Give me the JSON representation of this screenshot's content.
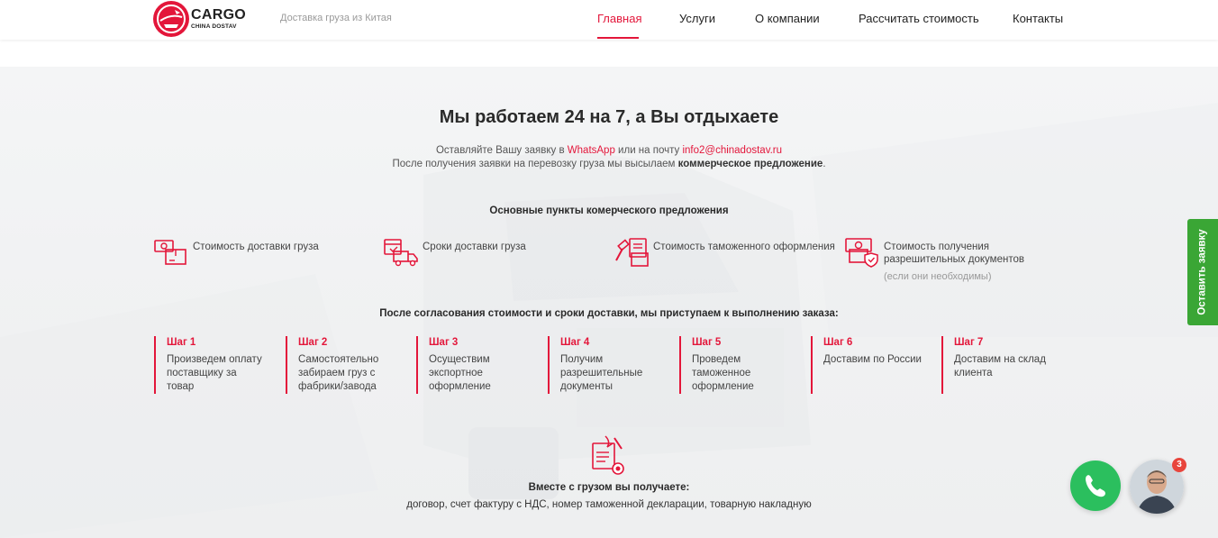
{
  "header": {
    "logo_title": "CARGO",
    "logo_subtitle": "CHINA DOSTAV",
    "tagline": "Доставка груза из Китая",
    "nav": [
      {
        "label": "Главная",
        "active": true
      },
      {
        "label": "Услуги"
      },
      {
        "label": "О компании"
      },
      {
        "label": "Рассчитать стоимость"
      },
      {
        "label": "Контакты"
      }
    ]
  },
  "hero": {
    "title": "Мы работаем 24 на 7, а Вы отдыхаете",
    "line1_prefix": "Оставляйте Вашу заявку в ",
    "line1_whatsapp": "WhatsApp",
    "line1_middle": " или на почту ",
    "line1_email": "info2@chinadostav.ru",
    "line2_prefix": "После получения заявки на перевозку груза мы высылаем ",
    "line2_bold": "коммерческое предложение",
    "line2_suffix": "."
  },
  "offer": {
    "heading": "Основные пункты комерческого предложения",
    "items": [
      {
        "icon": "money-box-icon",
        "label": "Стоимость доставки груза"
      },
      {
        "icon": "calendar-truck-icon",
        "label": "Сроки доставки груза"
      },
      {
        "icon": "customs-hammer-icon",
        "label": "Стоимость таможенного оформления"
      },
      {
        "icon": "money-shield-icon",
        "label_line1": "Стоимость получения",
        "label_line2": "разрешительных документов",
        "note": "(если они необходимы)"
      }
    ]
  },
  "steps": {
    "heading": "После согласования стоимости и сроки доставки, мы приступаем к выполнению заказа:",
    "items": [
      {
        "title": "Шаг 1",
        "l1": "Произведем оплату",
        "l2": "поставщику за",
        "l3": "товар"
      },
      {
        "title": "Шаг 2",
        "l1": "Самостоятельно",
        "l2": "забираем груз с",
        "l3": "фабрики/завода"
      },
      {
        "title": "Шаг 3",
        "l1": "Осуществим",
        "l2": "экспортное",
        "l3": "оформление"
      },
      {
        "title": "Шаг 4",
        "l1": "Получим",
        "l2": "разрешительные",
        "l3": "документы"
      },
      {
        "title": "Шаг 5",
        "l1": "Проведем",
        "l2": "таможенное",
        "l3": "оформление"
      },
      {
        "title": "Шаг 6",
        "l1": "Доставим по России",
        "l2": "",
        "l3": ""
      },
      {
        "title": "Шаг 7",
        "l1": "Доставим на склад",
        "l2": "клиента",
        "l3": ""
      }
    ]
  },
  "docs": {
    "title": "Вместе с грузом вы получаете:",
    "text": "договор, счет фактуру с НДС, номер таможенной декларации, товарную накладную"
  },
  "widgets": {
    "side_tab_label": "Оставить заявку",
    "chat_badge": "3"
  },
  "colors": {
    "accent": "#e3163a",
    "green_tab": "#3aa635",
    "whatsapp": "#2bbf5e"
  }
}
